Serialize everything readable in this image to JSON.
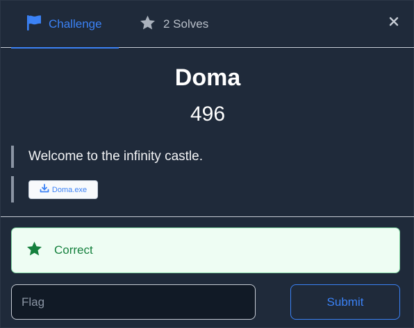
{
  "tabs": [
    {
      "label": "Challenge",
      "icon": "flag-icon",
      "active": true
    },
    {
      "label": "2 Solves",
      "icon": "star-icon",
      "active": false
    }
  ],
  "close_icon": "close-icon",
  "challenge": {
    "name": "Doma",
    "points": "496",
    "description": "Welcome to the infinity castle.",
    "file": {
      "label": "Doma.exe",
      "icon": "download-icon"
    }
  },
  "alert": {
    "text": "Correct",
    "icon": "star-icon",
    "status": "success"
  },
  "form": {
    "flag_placeholder": "Flag",
    "flag_value": "",
    "submit_label": "Submit"
  },
  "colors": {
    "accent": "#3b82f6",
    "background": "#1f2a3a",
    "success": "#15803d",
    "success_bg": "#eefdf3"
  }
}
